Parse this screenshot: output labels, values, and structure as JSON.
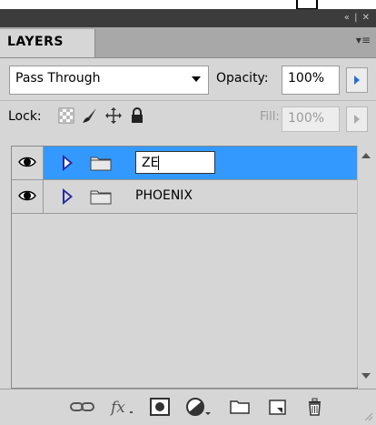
{
  "panel": {
    "tab_label": "LAYERS",
    "titlebar_controls": "« | ✕",
    "menu_glyph": "≡"
  },
  "blend": {
    "mode": "Pass Through",
    "opacity_label": "Opacity:",
    "opacity_value": "100%"
  },
  "lock": {
    "label": "Lock:",
    "fill_label": "Fill:",
    "fill_value": "100%"
  },
  "layers": [
    {
      "name_input_value": "ZE",
      "selected": true,
      "type": "group"
    },
    {
      "name": "PHOENIX",
      "selected": false,
      "type": "group"
    }
  ],
  "bottom_icons": [
    "link-layers-icon",
    "fx-icon",
    "layer-mask-icon",
    "adjustment-layer-icon",
    "new-group-icon",
    "new-layer-icon",
    "delete-layer-icon"
  ],
  "colors": {
    "selection": "#3399ff",
    "panel_bg": "#d6d6d6",
    "titlebar": "#3c3c3c"
  }
}
